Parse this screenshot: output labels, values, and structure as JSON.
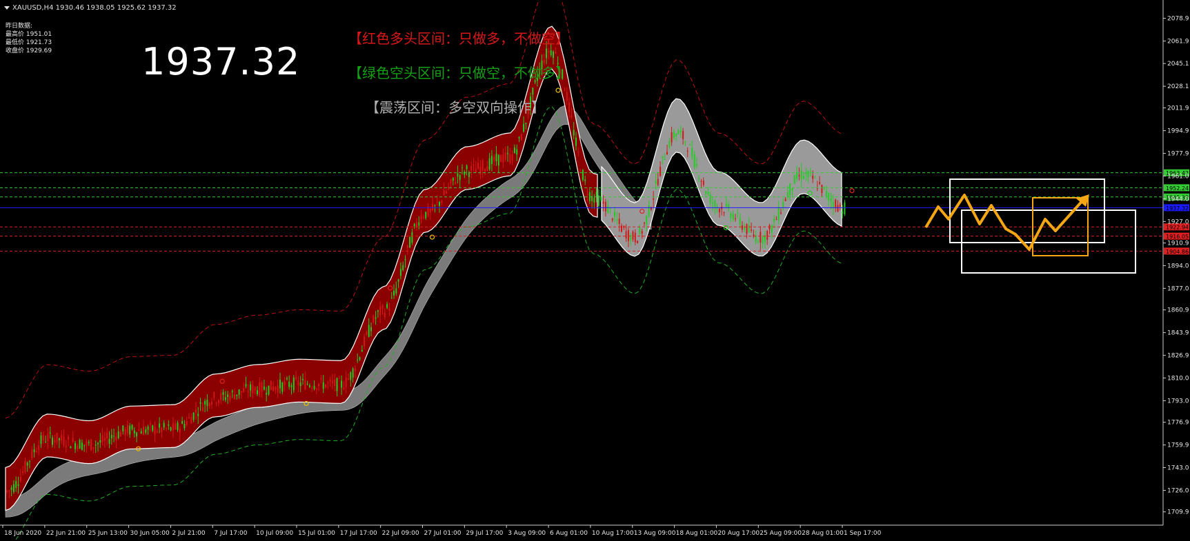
{
  "header": {
    "symbol": "XAUUSD,H4",
    "ohlc": "1930.46 1938.05 1925.62 1937.32"
  },
  "yesterday_info": {
    "title": "昨日数据:",
    "high": "最高价 1951.01",
    "low": "最低价 1921.73",
    "close": "收盘价 1929.69"
  },
  "big_price": "1937.32",
  "annotations": {
    "bull": "【红色多头区间：只做多，不做空】",
    "bear": "【绿色空头区间：只做空，不做多】",
    "range": "【震荡区间：多空双向操作】"
  },
  "colors": {
    "background": "#000000",
    "bull_band": "#8b0000",
    "range_band": "#9a9a9a",
    "bull_candle": "#d01818",
    "bear_candle": "#22cc22",
    "level_line_green": "#33cc33",
    "level_line_red": "#e02020",
    "current_line": "#1a1aff",
    "forecast_arrow": "#f5a614",
    "forecast_box": "#ffffff"
  },
  "chart_data": {
    "type": "line",
    "title": "XAUUSD,H4",
    "xlabel": "",
    "ylabel": "",
    "ylim": [
      1701,
      2090
    ],
    "x_ticks": [
      "18 Jun 2020",
      "22 Jun 21:00",
      "25 Jun 13:00",
      "30 Jun 05:00",
      "2 Jul 21:00",
      "7 Jul 17:00",
      "10 Jul 09:00",
      "15 Jul 01:00",
      "17 Jul 17:00",
      "22 Jul 09:00",
      "27 Jul 01:00",
      "29 Jul 17:00",
      "3 Aug 09:00",
      "6 Aug 01:00",
      "10 Aug 17:00",
      "13 Aug 09:00",
      "18 Aug 01:00",
      "20 Aug 17:00",
      "25 Aug 09:00",
      "28 Aug 01:00",
      "1 Sep 17:00"
    ],
    "y_ticks": [
      2078.9,
      2061.9,
      2045.1,
      2028.1,
      2011.9,
      1994.9,
      1977.9,
      1961.0,
      1944.0,
      1927.0,
      1910.9,
      1894.0,
      1877.0,
      1860.9,
      1843.9,
      1826.9,
      1810.0,
      1793.0,
      1776.9,
      1759.9,
      1743.0,
      1726.0,
      1709.9
    ],
    "close_path": [
      [
        "18 Jun 2020",
        1725
      ],
      [
        "22 Jun 21:00",
        1765
      ],
      [
        "25 Jun 13:00",
        1760
      ],
      [
        "30 Jun 05:00",
        1771
      ],
      [
        "2 Jul 21:00",
        1772
      ],
      [
        "7 Jul 17:00",
        1795
      ],
      [
        "10 Jul 09:00",
        1802
      ],
      [
        "15 Jul 01:00",
        1806
      ],
      [
        "17 Jul 17:00",
        1805
      ],
      [
        "22 Jul 09:00",
        1860
      ],
      [
        "27 Jul 01:00",
        1933
      ],
      [
        "29 Jul 17:00",
        1965
      ],
      [
        "3 Aug 09:00",
        1975
      ],
      [
        "6 Aug 01:00",
        2055
      ],
      [
        "10 Aug 17:00",
        1945
      ],
      [
        "13 Aug 09:00",
        1915
      ],
      [
        "18 Aug 01:00",
        1993
      ],
      [
        "20 Aug 17:00",
        1938
      ],
      [
        "25 Aug 09:00",
        1915
      ],
      [
        "28 Aug 01:00",
        1962
      ],
      [
        "1 Sep 17:00",
        1937
      ]
    ],
    "levels": [
      {
        "label": "1963.42",
        "value": 1963.42,
        "color": "#33cc33"
      },
      {
        "label": "1952.24",
        "value": 1952.24,
        "color": "#33cc33"
      },
      {
        "label": "1945.33",
        "value": 1945.33,
        "color": "#33cc33"
      },
      {
        "label": "1937.32",
        "value": 1937.32,
        "color": "#1a1aff"
      },
      {
        "label": "1922.94",
        "value": 1922.94,
        "color": "#e02020"
      },
      {
        "label": "1916.05",
        "value": 1916.05,
        "color": "#e02020"
      },
      {
        "label": "1904.86",
        "value": 1904.86,
        "color": "#e02020"
      }
    ],
    "grid": false,
    "legend": "none"
  }
}
